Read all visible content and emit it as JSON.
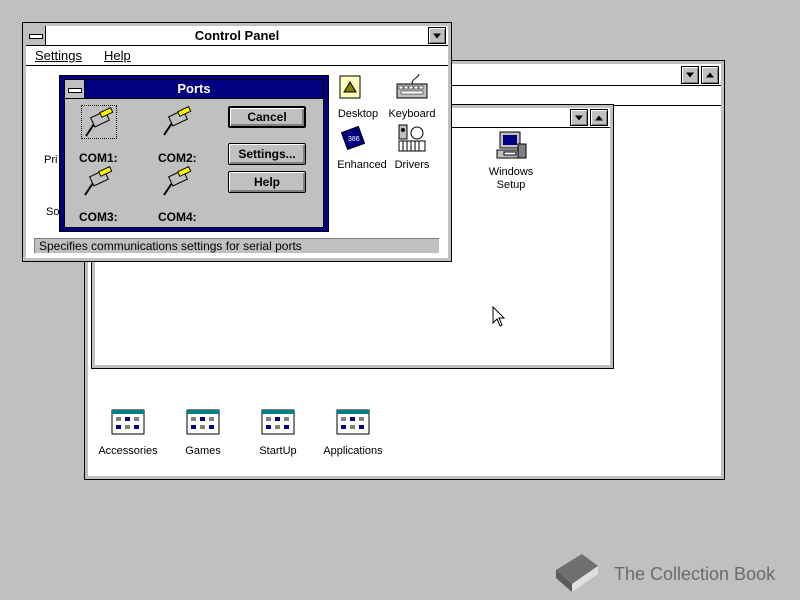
{
  "control_panel": {
    "title": "Control Panel",
    "menu": [
      "Settings",
      "Help"
    ],
    "icons_visible": [
      {
        "label": "Keyboard"
      },
      {
        "label": "Desktop"
      },
      {
        "label": "Enhanced"
      },
      {
        "label": "Drivers"
      },
      {
        "label": "Pri"
      },
      {
        "label": "So"
      }
    ],
    "status_text": "Specifies communications settings for serial ports"
  },
  "ports_dialog": {
    "title": "Ports",
    "ports": [
      {
        "label": "COM1:"
      },
      {
        "label": "COM2:"
      },
      {
        "label": "COM3:"
      },
      {
        "label": "COM4:"
      }
    ],
    "buttons": {
      "cancel": "Cancel",
      "settings": "Settings...",
      "help": "Help"
    }
  },
  "main_group": {
    "icons": [
      {
        "label": "Accessories"
      },
      {
        "label": "Games"
      },
      {
        "label": "StartUp"
      },
      {
        "label": "Applications"
      }
    ]
  },
  "inner_group": {
    "icons": [
      {
        "label": "Windows Setup"
      }
    ]
  },
  "watermark": {
    "text": "The Collection Book"
  }
}
